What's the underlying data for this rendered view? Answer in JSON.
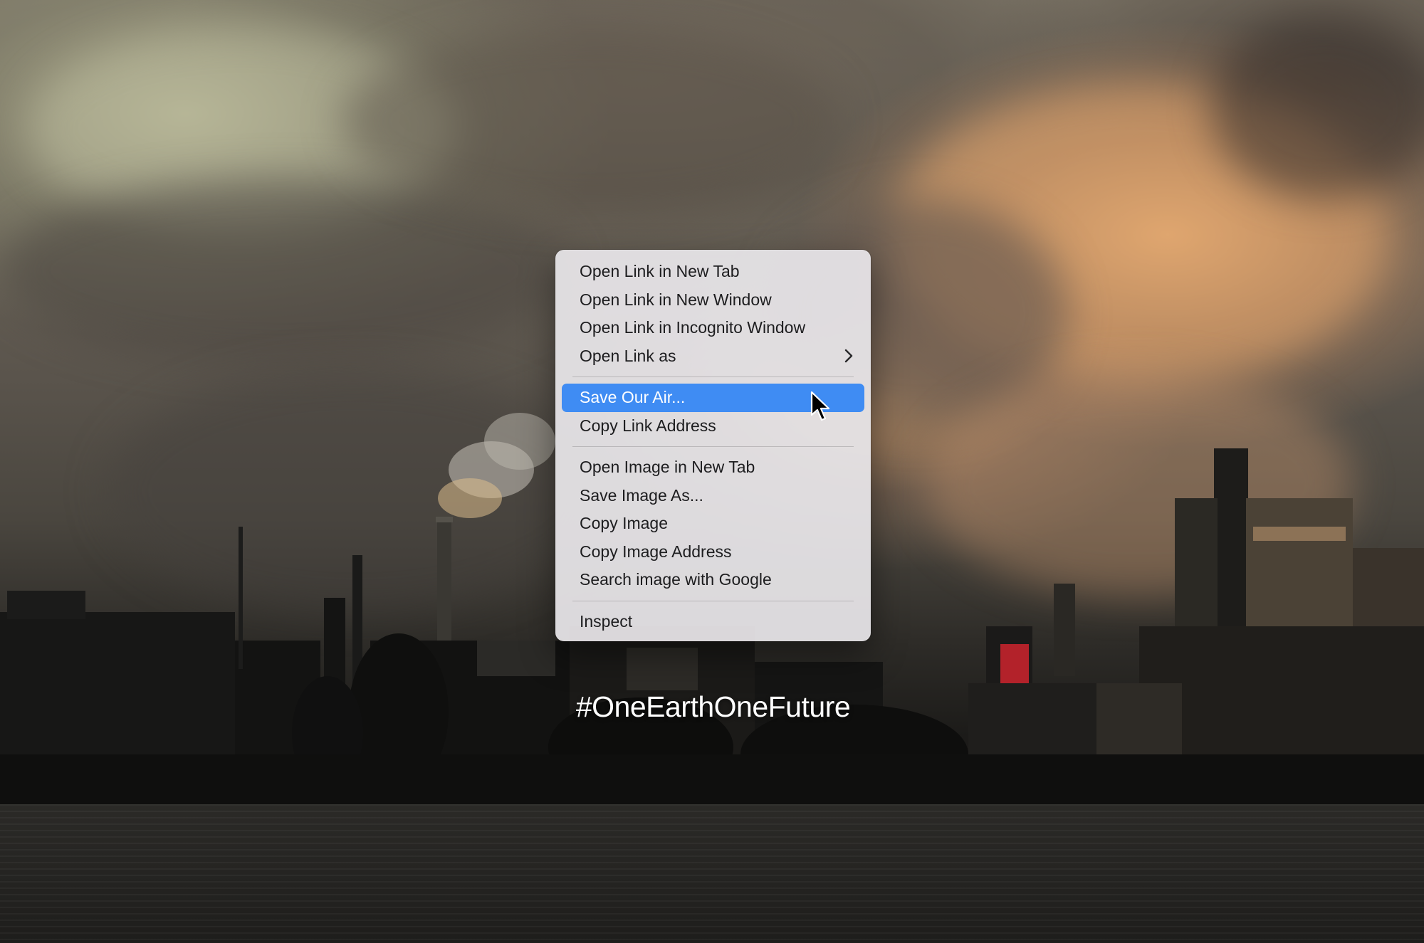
{
  "context_menu": {
    "items": [
      {
        "label": "Open Link in New Tab"
      },
      {
        "label": "Open Link in New Window"
      },
      {
        "label": "Open Link in Incognito Window"
      },
      {
        "label": "Open Link as",
        "submenu_icon": "chevron-right-icon"
      },
      {
        "label": "Save Our Air...",
        "highlighted": true
      },
      {
        "label": "Copy Link Address"
      },
      {
        "label": "Open Image in New Tab"
      },
      {
        "label": "Save Image As..."
      },
      {
        "label": "Copy Image"
      },
      {
        "label": "Copy Image Address"
      },
      {
        "label": "Search image with Google"
      },
      {
        "label": "Inspect"
      }
    ]
  },
  "hashtag": "#OneEarthOneFuture",
  "colors": {
    "highlight": "#3f8cf3",
    "menu_text": "#1d1d1f"
  },
  "cursor_icon": "arrow-pointer-icon"
}
